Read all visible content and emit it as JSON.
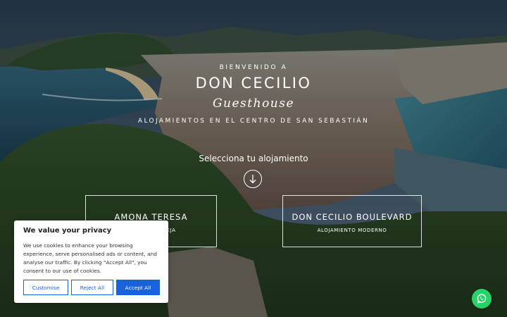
{
  "hero": {
    "kicker": "BIENVENIDO A",
    "brand": "DON CECILIO",
    "script": "Guesthouse",
    "tagline": "ALOJAMIENTOS EN EL CENTRO DE SAN SEBASTIÁN",
    "select_label": "Selecciona tu alojamiento"
  },
  "cards": [
    {
      "title": "AMONA TERESA",
      "subtitle": "N LA PARTE VIEJA"
    },
    {
      "title": "DON CECILIO BOULEVARD",
      "subtitle": "ALOJAMIENTO MODERNO"
    }
  ],
  "cookie": {
    "title": "We value your privacy",
    "text": "We use cookies to enhance your browsing experience, serve personalised ads or content, and analyse our traffic. By clicking \"Accept All\", you consent to our use of cookies.",
    "customise": "Customise",
    "reject": "Reject All",
    "accept": "Accept All",
    "accent": "#1863dc"
  },
  "whatsapp": {
    "icon": "whatsapp-icon",
    "color": "#25d366"
  },
  "icons": {
    "scroll_down": "arrow-down-icon"
  }
}
